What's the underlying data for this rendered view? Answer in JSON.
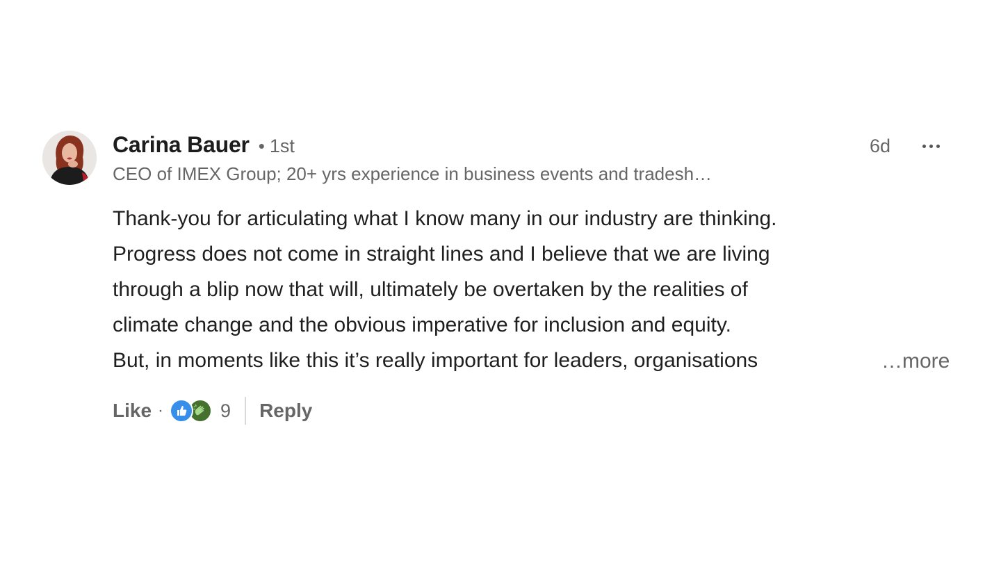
{
  "comment": {
    "author": {
      "name": "Carina Bauer",
      "separator": "•",
      "connection_degree": "1st",
      "headline": "CEO of IMEX Group; 20+ yrs experience in business events and tradesh…",
      "avatar": "profile-photo"
    },
    "timestamp": "6d",
    "menu_icon": "more-horizontal-icon",
    "body_lines": [
      "Thank-you for articulating what I know many in our industry are thinking.",
      "Progress does not come in straight lines and I believe that we are living",
      "through a blip now that will, ultimately be overtaken by the realities of",
      "climate change and the obvious imperative for inclusion and equity.",
      "But, in moments like this it’s really important for leaders, organisations"
    ],
    "see_more_label": "…more",
    "actions": {
      "like_label": "Like",
      "separator": "·",
      "reactions": [
        {
          "type": "like",
          "icon": "thumbs-up-icon",
          "color": "#378fe9"
        },
        {
          "type": "celebrate",
          "icon": "clapping-hands-icon",
          "color": "#44712e"
        }
      ],
      "reaction_count": "9",
      "reply_label": "Reply"
    }
  }
}
